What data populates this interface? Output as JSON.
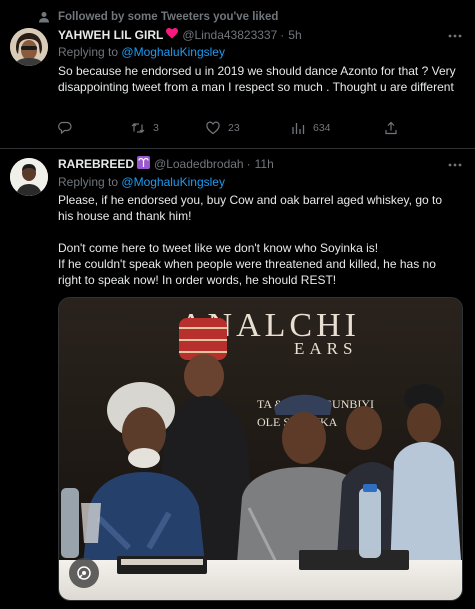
{
  "social_context": {
    "text": "Followed by some Tweeters you've liked"
  },
  "tweets": [
    {
      "name": "YAHWEH LIL GIRL",
      "badge": "heart",
      "handle": "@Linda43823337",
      "time": "5h",
      "replying_to_prefix": "Replying to",
      "replying_to": "@MoghaluKingsley",
      "text": "So because  he endorsed  u in 2019  we should  dance Azonto for that ? Very disappointing  tweet from a man I respect so much . Thought  u are different",
      "actions": {
        "replies": "",
        "retweets": "3",
        "likes": "23",
        "views": "634"
      }
    },
    {
      "name": "RAREBREED",
      "badge": "aries",
      "handle": "@Loadedbrodah",
      "time": "11h",
      "replying_to_prefix": "Replying to",
      "replying_to": "@MoghaluKingsley",
      "paragraphs": [
        "Please, if he endorsed you, buy Cow and oak barrel aged whiskey, go to his house and thank him!",
        "Don't come here to tweet like we don't know who Soyinka is!",
        "If he couldn't speak when people were threatened and killed, he has no right to speak now! In order words, he should REST!"
      ],
      "media": {
        "banner_text": "ANALCHI",
        "banner_sub": "EARS",
        "banner_line2": "TA & Yemi OGUNBIYI",
        "banner_line3": "OLE SOYINKA"
      }
    }
  ],
  "colors": {
    "accent": "#1d9bf0",
    "muted": "#71767b",
    "text": "#e7e9ea",
    "heart": "#f91880",
    "aries": "#9b59d0"
  }
}
